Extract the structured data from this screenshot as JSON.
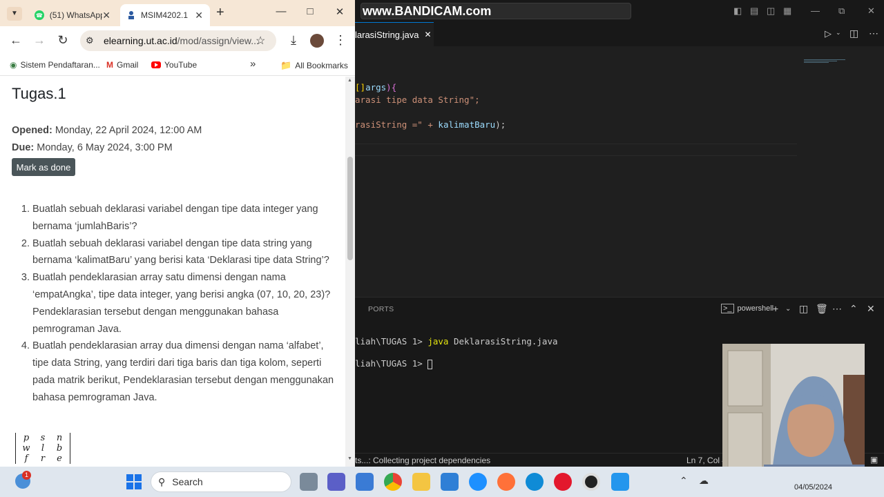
{
  "browser": {
    "tabs": [
      {
        "title": "(51) WhatsApp",
        "active": false
      },
      {
        "title": "MSIM4202.1",
        "active": true
      }
    ],
    "new_tab_label": "+",
    "url_host": "elearning.ut.ac.id",
    "url_path": "/mod/assign/view...",
    "bookmarks": [
      {
        "label": "Sistem Pendaftaran..."
      },
      {
        "label": "Gmail"
      },
      {
        "label": "YouTube"
      }
    ],
    "bookmarks_overflow": "»",
    "all_bookmarks": "All Bookmarks"
  },
  "assignment": {
    "title": "Tugas.1",
    "opened_label": "Opened:",
    "opened_value": "Monday, 22 April 2024, 12:00 AM",
    "due_label": "Due:",
    "due_value": "Monday, 6 May 2024, 3:00 PM",
    "mark_done": "Mark as done",
    "tasks": [
      "Buatlah sebuah deklarasi variabel dengan tipe data integer yang bernama ‘jumlahBaris’?",
      "Buatlah sebuah deklarasi variabel dengan tipe data string yang bernama ‘kalimatBaru’ yang berisi kata ‘Deklarasi tipe data String’?",
      "Buatlah pendeklarasian array satu dimensi dengan nama ‘empatAngka’, tipe data integer, yang berisi angka (07, 10, 20, 23)? Pendeklarasian tersebut dengan menggunakan bahasa pemrograman Java.",
      "Buatlah pendeklarasian array dua dimensi dengan nama ‘alfabet’, tipe data String, yang terdiri dari tiga baris dan tiga kolom, seperti pada matrik berikut, Pendeklarasian tersebut dengan menggunakan bahasa pemrograman Java."
    ],
    "matrix": [
      [
        "p",
        "s",
        "n"
      ],
      [
        "w",
        "l",
        "b"
      ],
      [
        "f",
        "r",
        "e"
      ]
    ]
  },
  "vscode": {
    "watermark": "www.BANDICAM.com",
    "editor_tab": "larasiString.java",
    "code": {
      "line1_a": "[]",
      "line1_b": "args",
      "line1_c": "){",
      "line2": "arasi tipe data String\";",
      "line3_a": "rasiString =\" + ",
      "line3_b": "kalimatBaru",
      "line3_c": ");"
    },
    "panel_tab": "PORTS",
    "terminal_name": "powershell",
    "terminal_line1_prompt": "liah\\TUGAS 1> ",
    "terminal_line1_cmd": "java",
    "terminal_line1_args": " DeklarasiString.java",
    "terminal_line2_prompt": "liah\\TUGAS 1> ",
    "status_left": "ts...: Collecting project dependencies",
    "status_right": "Ln 7, Col 4"
  },
  "taskbar": {
    "search_label": "Search",
    "notification_count": "1",
    "date": "04/05/2024"
  }
}
